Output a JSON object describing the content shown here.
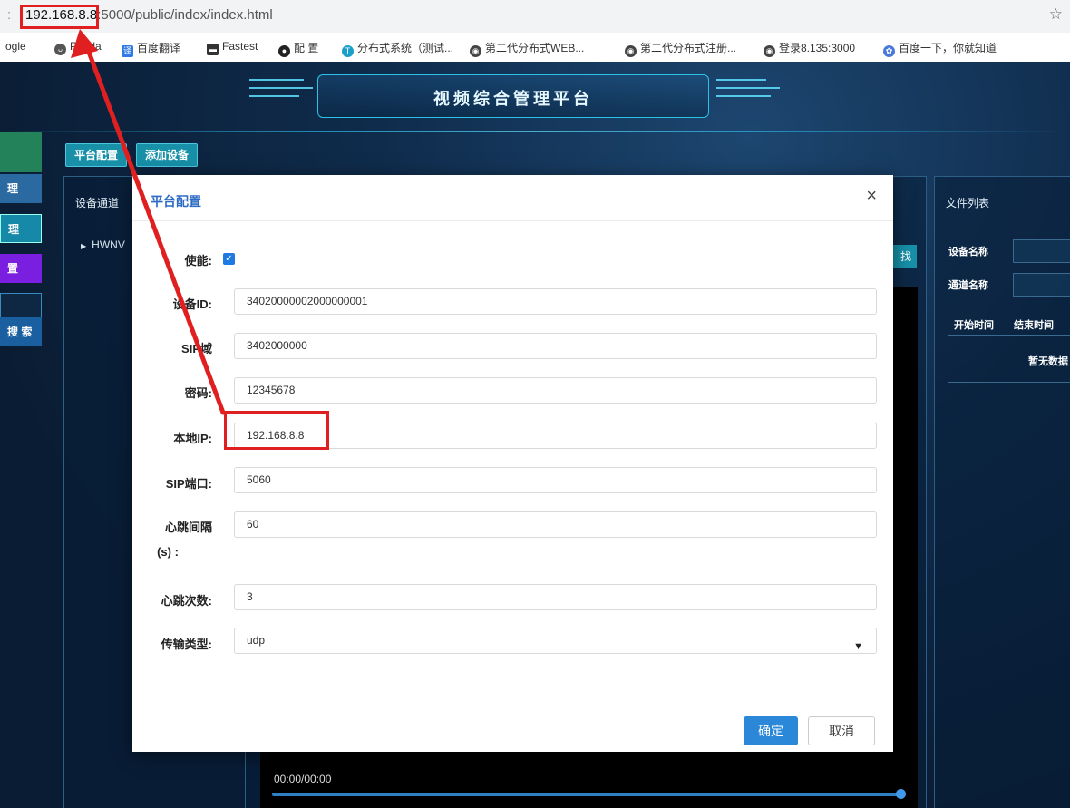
{
  "browser": {
    "url_host": "192.168.8.8",
    "url_rest": ":5000/public/index/index.html",
    "bookmarks": [
      {
        "label": "ogle"
      },
      {
        "label": "Panda"
      },
      {
        "label": "百度翻译"
      },
      {
        "label": "Fastest"
      },
      {
        "label": "配 置"
      },
      {
        "label": "分布式系统（测试..."
      },
      {
        "label": "第二代分布式WEB..."
      },
      {
        "label": "第二代分布式注册..."
      },
      {
        "label": "登录8.135:3000"
      },
      {
        "label": "百度一下，你就知道"
      }
    ]
  },
  "app": {
    "title": "视频综合管理平台",
    "toolbar": {
      "platform_config": "平台配置",
      "add_device": "添加设备"
    },
    "left_nav": [
      {
        "label": "理"
      },
      {
        "label": "理"
      },
      {
        "label": "置"
      },
      {
        "label": ""
      },
      {
        "label": "搜 索"
      }
    ],
    "device_panel": {
      "header": "设备通道",
      "tree_item": "HWNV"
    },
    "search_button": "找",
    "file_panel": {
      "header": "文件列表",
      "device_name_label": "设备名称",
      "channel_name_label": "通道名称",
      "start_time": "开始时间",
      "end_time": "结束时间",
      "empty": "暂无数据"
    },
    "video": {
      "time": "00:00/00:00",
      "progress": 1.0
    }
  },
  "modal": {
    "title": "平台配置",
    "close": "×",
    "fields": {
      "enable": {
        "label": "使能:",
        "checked": true
      },
      "device_id": {
        "label": "设备ID:",
        "value": "34020000002000000001"
      },
      "sip_domain": {
        "label": "SIP域",
        "value": "3402000000"
      },
      "password": {
        "label": "密码:",
        "value": "12345678"
      },
      "local_ip": {
        "label": "本地IP:",
        "value": "192.168.8.8"
      },
      "sip_port": {
        "label": "SIP端口:",
        "value": "5060"
      },
      "heartbeat_interval": {
        "label": "心跳间隔",
        "label2": "(s) :",
        "value": "60"
      },
      "heartbeat_count": {
        "label": "心跳次数:",
        "value": "3"
      },
      "transport": {
        "label": "传输类型:",
        "value": "udp"
      }
    },
    "ok": "确定",
    "cancel": "取消"
  },
  "colors": {
    "annotation": "#e02020",
    "primary": "#2b88d8",
    "accent": "#5fe0ff"
  }
}
